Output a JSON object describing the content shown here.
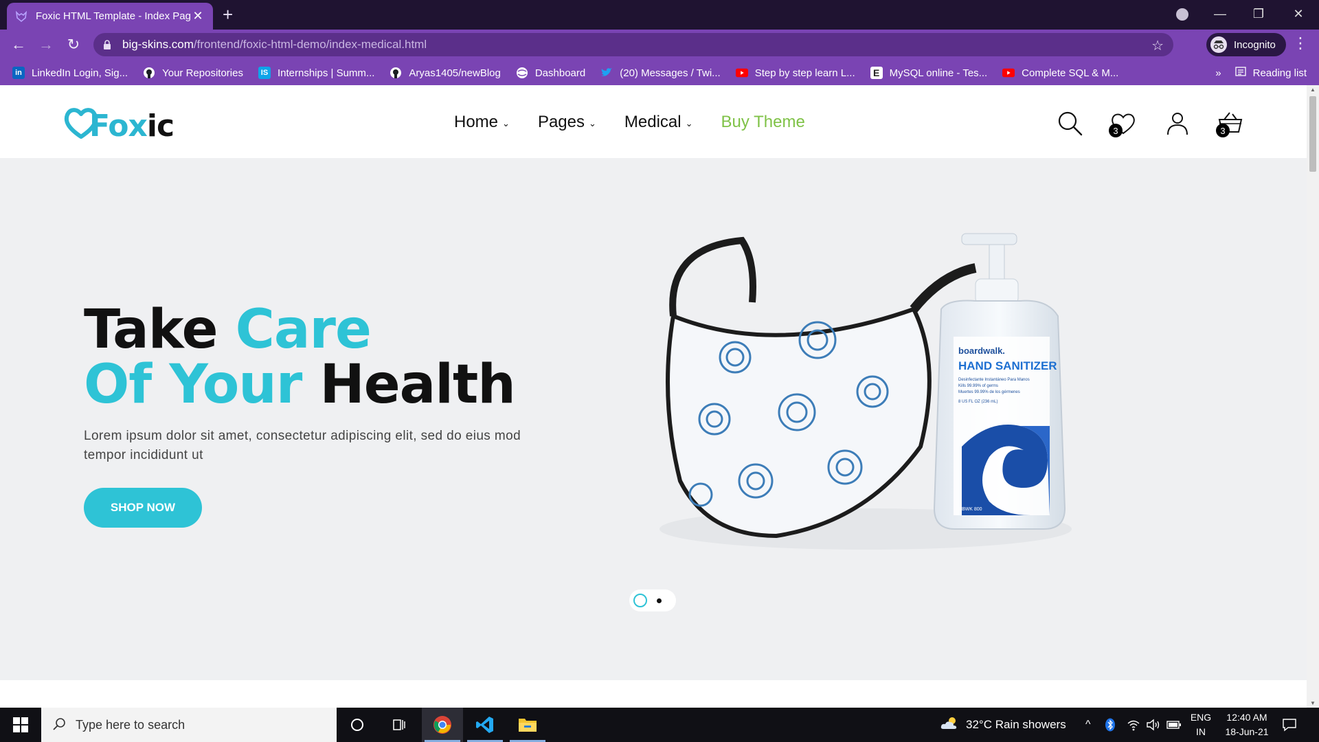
{
  "browser": {
    "tab_title": "Foxic HTML Template - Index Pag",
    "address_host": "big-skins.com",
    "address_path": "/frontend/foxic-html-demo/index-medical.html",
    "profile_label": "Incognito",
    "reading_list_label": "Reading list",
    "bookmarks": [
      {
        "label": "LinkedIn Login, Sig...",
        "icon": "linkedin-icon"
      },
      {
        "label": "Your Repositories",
        "icon": "github-icon"
      },
      {
        "label": "Internships | Summ...",
        "icon": "internshala-icon"
      },
      {
        "label": "Aryas1405/newBlog",
        "icon": "github-icon"
      },
      {
        "label": "Dashboard",
        "icon": "globe-icon"
      },
      {
        "label": "(20) Messages / Twi...",
        "icon": "twitter-icon"
      },
      {
        "label": "Step by step learn L...",
        "icon": "youtube-icon"
      },
      {
        "label": "MySQL online - Tes...",
        "icon": "e-icon"
      },
      {
        "label": "Complete SQL & M...",
        "icon": "youtube-icon"
      }
    ]
  },
  "site": {
    "logo_part1": "Fox",
    "logo_part2": "ic",
    "nav": {
      "home": "Home",
      "pages": "Pages",
      "medical": "Medical",
      "buy_theme": "Buy Theme"
    },
    "wishlist_count": "3",
    "cart_count": "3",
    "colors": {
      "accent": "#2ec3d6",
      "buy_theme": "#7fc247"
    }
  },
  "hero": {
    "line1_a": "Take ",
    "line1_b": "Care",
    "line2_a": "Of Your ",
    "line2_b": "Health",
    "lead": "Lorem ipsum dolor sit amet, consectetur adipiscing elit, sed do eius mod tempor incididunt ut",
    "cta": "SHOP NOW",
    "bottle_brand": "boardwalk.",
    "bottle_product": "HAND SANITIZER",
    "bottle_line1": "Desinfectante Instantáneo Para Manos",
    "bottle_line2": "Kills 99.99% of germs",
    "bottle_line3": "Muertes 99.99% de los gérmenes",
    "bottle_size": "8 US FL OZ (236 mL)",
    "bottle_code": "BWK 800",
    "slide_index": 1,
    "slide_count": 2
  },
  "taskbar": {
    "search_placeholder": "Type here to search",
    "weather": "32°C  Rain showers",
    "lang1": "ENG",
    "lang2": "IN",
    "time": "12:40 AM",
    "date": "18-Jun-21"
  }
}
